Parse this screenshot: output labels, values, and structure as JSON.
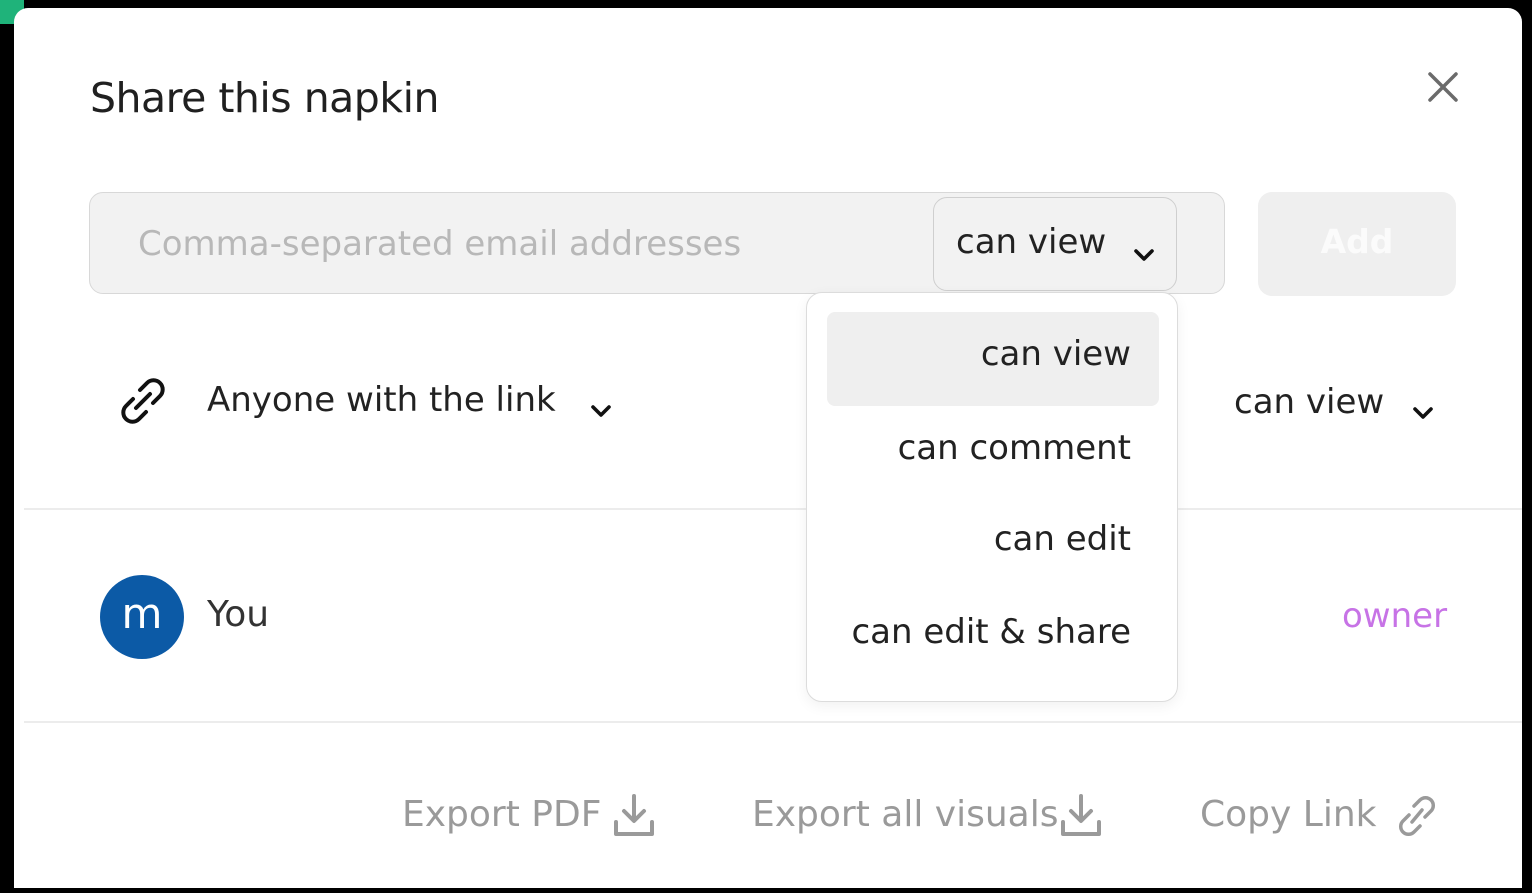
{
  "dialog": {
    "title": "Share this napkin",
    "close_icon": "close-icon"
  },
  "invite": {
    "email_placeholder": "Comma-separated email addresses",
    "email_value": "",
    "permission_selected": "can view",
    "add_label": "Add"
  },
  "permission_menu": {
    "items": [
      {
        "label": "can view",
        "selected": true
      },
      {
        "label": "can comment",
        "selected": false
      },
      {
        "label": "can edit",
        "selected": false
      },
      {
        "label": "can edit & share",
        "selected": false
      }
    ]
  },
  "link_sharing": {
    "icon": "link-icon",
    "scope": "Anyone with the link",
    "permission": "can view"
  },
  "members": [
    {
      "avatar_initial": "m",
      "name": "You",
      "role": "owner",
      "avatar_color": "#0c5aa6",
      "role_color": "#c773e6"
    }
  ],
  "footer": {
    "export_pdf": "Export PDF",
    "export_all": "Export all visuals",
    "copy_link": "Copy Link"
  }
}
